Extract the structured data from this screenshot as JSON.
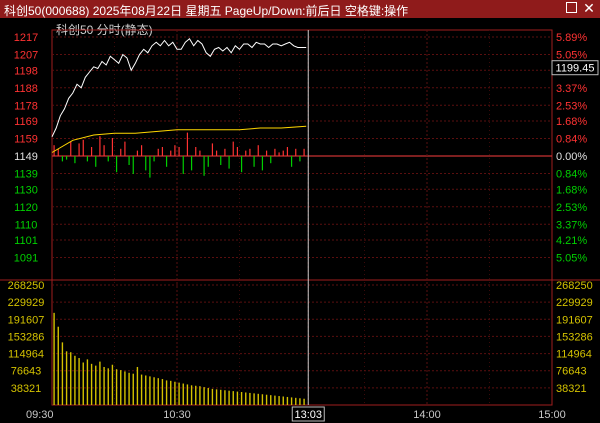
{
  "window": {
    "title": "科创50(000688) 2025年08月22日 星期五 PageUp/Down:前后日 空格键:操作"
  },
  "panel": {
    "subtitle": "科创50  分时(静态)"
  },
  "colors": {
    "up": "#ff3232",
    "down": "#00d000",
    "price_line": "#ffffff",
    "avg_line": "#ffd700",
    "volume": "#d4c200",
    "grid_red": "#5a0f0f",
    "axis": "#a01e1e"
  },
  "chart_data": {
    "type": "line",
    "subtype": "intraday-timeshare",
    "price_axis": {
      "ylim": [
        1081,
        1217
      ],
      "ticks": [
        "1217",
        "1207",
        "1198",
        "1188",
        "1178",
        "1169",
        "1159",
        "1149",
        "1139",
        "1130",
        "1120",
        "1110",
        "1101",
        "1091"
      ],
      "tick_values": [
        1217,
        1207,
        1198,
        1188,
        1178,
        1169,
        1159,
        1149,
        1139,
        1130,
        1120,
        1110,
        1101,
        1091
      ],
      "prev_close": 1149
    },
    "pct_axis": {
      "ticks": [
        "5.89%",
        "5.05%",
        "4.21%",
        "3.37%",
        "2.53%",
        "1.68%",
        "0.84%",
        "0.00%",
        "0.84%",
        "1.68%",
        "2.53%",
        "3.37%",
        "4.21%",
        "5.05%"
      ]
    },
    "current_price_label": "1199.45",
    "time_axis": {
      "ticks": [
        "09:30",
        "10:30",
        "13:03",
        "14:00",
        "15:00"
      ],
      "tick_minutes": [
        0,
        60,
        123,
        180,
        240
      ],
      "total_minutes": 240,
      "cursor_time": "13:03",
      "cursor_minute": 123
    },
    "series": [
      {
        "name": "price",
        "x": [
          0,
          2,
          4,
          6,
          8,
          10,
          12,
          14,
          16,
          18,
          20,
          22,
          24,
          26,
          28,
          30,
          32,
          34,
          36,
          38,
          40,
          42,
          44,
          46,
          48,
          50,
          52,
          54,
          56,
          58,
          60,
          62,
          64,
          66,
          68,
          70,
          72,
          74,
          76,
          78,
          80,
          82,
          84,
          86,
          88,
          90,
          92,
          94,
          96,
          98,
          100,
          102,
          104,
          106,
          108,
          110,
          112,
          114,
          116,
          118,
          120,
          122
        ],
        "values": [
          1160,
          1165,
          1172,
          1176,
          1182,
          1185,
          1190,
          1188,
          1194,
          1197,
          1200,
          1199,
          1203,
          1201,
          1206,
          1204,
          1202,
          1207,
          1205,
          1198,
          1202,
          1207,
          1210,
          1208,
          1212,
          1214,
          1212,
          1215,
          1212,
          1214,
          1210,
          1210,
          1214,
          1216,
          1212,
          1215,
          1213,
          1208,
          1206,
          1210,
          1211,
          1209,
          1211,
          1208,
          1212,
          1210,
          1213,
          1213,
          1211,
          1214,
          1213,
          1213,
          1211,
          1213,
          1213,
          1212,
          1213,
          1214,
          1212,
          1211,
          1211,
          1211
        ]
      },
      {
        "name": "average",
        "x": [
          0,
          10,
          20,
          30,
          40,
          50,
          60,
          70,
          80,
          90,
          100,
          110,
          122
        ],
        "values": [
          1151,
          1158,
          1161,
          1162,
          1162,
          1163,
          1164,
          1164,
          1164,
          1164,
          1165,
          1165,
          1166
        ]
      }
    ],
    "volume_axis": {
      "ticks": [
        "268250",
        "229929",
        "191607",
        "153286",
        "114964",
        "76643",
        "38321"
      ],
      "tick_values": [
        268250,
        229929,
        191607,
        153286,
        114964,
        76643,
        38321
      ],
      "ylim": [
        0,
        268250
      ]
    },
    "volume": {
      "x": [
        1,
        3,
        5,
        7,
        9,
        11,
        13,
        15,
        17,
        19,
        21,
        23,
        25,
        27,
        29,
        31,
        33,
        35,
        37,
        39,
        41,
        43,
        45,
        47,
        49,
        51,
        53,
        55,
        57,
        59,
        61,
        63,
        65,
        67,
        69,
        71,
        73,
        75,
        77,
        79,
        81,
        83,
        85,
        87,
        89,
        91,
        93,
        95,
        97,
        99,
        101,
        103,
        105,
        107,
        109,
        111,
        113,
        115,
        117,
        119,
        121
      ],
      "values": [
        206000,
        175000,
        140000,
        120000,
        118000,
        110000,
        105000,
        95000,
        102000,
        92000,
        88000,
        97000,
        85000,
        82000,
        90000,
        80000,
        78000,
        75000,
        72000,
        70000,
        85000,
        68000,
        66000,
        64000,
        62000,
        60000,
        58000,
        55000,
        54000,
        52000,
        50000,
        48000,
        46000,
        44000,
        43000,
        42000,
        40000,
        38000,
        36000,
        35000,
        34000,
        33000,
        32000,
        31000,
        30000,
        29000,
        28000,
        27000,
        26000,
        25000,
        24000,
        23000,
        22000,
        21000,
        20000,
        19000,
        18000,
        17000,
        16000,
        15000,
        14000
      ]
    },
    "breadth": {
      "x": [
        1,
        3,
        5,
        7,
        9,
        11,
        13,
        15,
        17,
        19,
        21,
        23,
        25,
        27,
        29,
        31,
        33,
        35,
        37,
        39,
        41,
        43,
        45,
        47,
        49,
        51,
        53,
        55,
        57,
        59,
        61,
        63,
        65,
        67,
        69,
        71,
        73,
        75,
        77,
        79,
        81,
        83,
        85,
        87,
        89,
        91,
        93,
        95,
        97,
        99,
        101,
        103,
        105,
        107,
        109,
        111,
        113,
        115,
        117,
        119,
        121
      ],
      "values": [
        6,
        4,
        -3,
        -2,
        8,
        -4,
        7,
        9,
        -3,
        5,
        -6,
        11,
        6,
        -3,
        10,
        -9,
        4,
        8,
        -5,
        -10,
        3,
        6,
        -8,
        -12,
        -3,
        4,
        5,
        -6,
        3,
        6,
        5,
        -10,
        13,
        -8,
        5,
        3,
        -11,
        -6,
        7,
        3,
        -5,
        4,
        -7,
        8,
        5,
        -9,
        3,
        4,
        -6,
        6,
        -8,
        3,
        -4,
        4,
        2,
        3,
        5,
        -6,
        4,
        -3,
        4
      ]
    }
  }
}
